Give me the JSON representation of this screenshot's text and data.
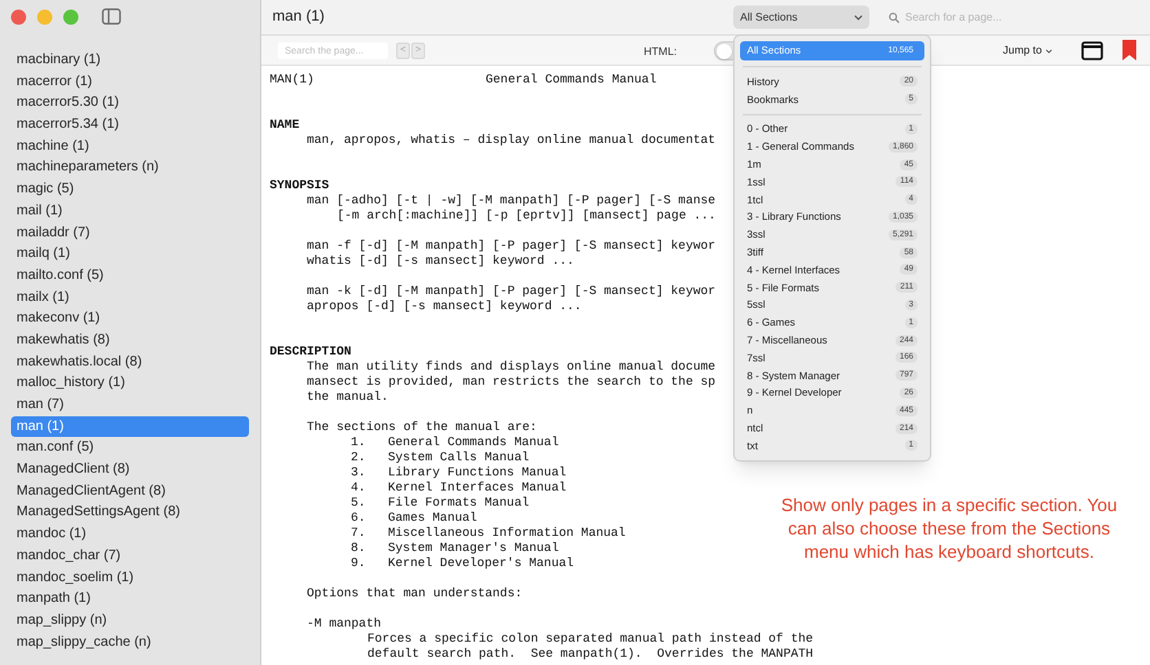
{
  "sidebar": {
    "items": [
      {
        "label": "macbinary (1)",
        "selected": false
      },
      {
        "label": "macerror (1)",
        "selected": false
      },
      {
        "label": "macerror5.30 (1)",
        "selected": false
      },
      {
        "label": "macerror5.34 (1)",
        "selected": false
      },
      {
        "label": "machine (1)",
        "selected": false
      },
      {
        "label": "machineparameters (n)",
        "selected": false
      },
      {
        "label": "magic (5)",
        "selected": false
      },
      {
        "label": "mail (1)",
        "selected": false
      },
      {
        "label": "mailaddr (7)",
        "selected": false
      },
      {
        "label": "mailq (1)",
        "selected": false
      },
      {
        "label": "mailto.conf (5)",
        "selected": false
      },
      {
        "label": "mailx (1)",
        "selected": false
      },
      {
        "label": "makeconv (1)",
        "selected": false
      },
      {
        "label": "makewhatis (8)",
        "selected": false
      },
      {
        "label": "makewhatis.local (8)",
        "selected": false
      },
      {
        "label": "malloc_history (1)",
        "selected": false
      },
      {
        "label": "man (7)",
        "selected": false
      },
      {
        "label": "man (1)",
        "selected": true
      },
      {
        "label": "man.conf (5)",
        "selected": false
      },
      {
        "label": "ManagedClient (8)",
        "selected": false
      },
      {
        "label": "ManagedClientAgent (8)",
        "selected": false
      },
      {
        "label": "ManagedSettingsAgent (8)",
        "selected": false
      },
      {
        "label": "mandoc (1)",
        "selected": false
      },
      {
        "label": "mandoc_char (7)",
        "selected": false
      },
      {
        "label": "mandoc_soelim (1)",
        "selected": false
      },
      {
        "label": "manpath (1)",
        "selected": false
      },
      {
        "label": "map_slippy (n)",
        "selected": false
      },
      {
        "label": "map_slippy_cache (n)",
        "selected": false
      }
    ]
  },
  "toolbar": {
    "title": "man (1)",
    "section_popup": "All Sections",
    "search": {
      "placeholder": "Search for a page..."
    }
  },
  "find_bar": {
    "search": {
      "placeholder": "Search the page..."
    },
    "prev": "<",
    "next": ">",
    "html_label": "HTML:",
    "html_on": false,
    "jump_to": "Jump to"
  },
  "page": {
    "header": {
      "left": "MAN(1)",
      "center": "General Commands Manual"
    },
    "lines": [
      {
        "kind": "blank"
      },
      {
        "kind": "blank"
      },
      {
        "kind": "heading",
        "text": "NAME"
      },
      {
        "kind": "indent",
        "text": "man, apropos, whatis – display online manual documentat"
      },
      {
        "kind": "blank"
      },
      {
        "kind": "blank"
      },
      {
        "kind": "heading",
        "text": "SYNOPSIS"
      },
      {
        "kind": "indent",
        "text": "man [-adho] [-t | -w] [-M manpath] [-P pager] [-S manse"
      },
      {
        "kind": "wrap",
        "text": "[-m arch[:machine]] [-p [eprtv]] [mansect] page ..."
      },
      {
        "kind": "blank"
      },
      {
        "kind": "indent",
        "text": "man -f [-d] [-M manpath] [-P pager] [-S mansect] keywor"
      },
      {
        "kind": "indent",
        "text": "whatis [-d] [-s mansect] keyword ..."
      },
      {
        "kind": "blank"
      },
      {
        "kind": "indent",
        "text": "man -k [-d] [-M manpath] [-P pager] [-S mansect] keywor"
      },
      {
        "kind": "indent",
        "text": "apropos [-d] [-s mansect] keyword ..."
      },
      {
        "kind": "blank"
      },
      {
        "kind": "blank"
      },
      {
        "kind": "heading",
        "text": "DESCRIPTION"
      },
      {
        "kind": "indent",
        "text": "The man utility finds and displays online manual docume"
      },
      {
        "kind": "indent",
        "text": "mansect is provided, man restricts the search to the sp"
      },
      {
        "kind": "indent",
        "text": "the manual."
      },
      {
        "kind": "blank"
      },
      {
        "kind": "indent",
        "text": "The sections of the manual are:"
      },
      {
        "kind": "item",
        "number": "1.",
        "text": "General Commands Manual"
      },
      {
        "kind": "item",
        "number": "2.",
        "text": "System Calls Manual"
      },
      {
        "kind": "item",
        "number": "3.",
        "text": "Library Functions Manual"
      },
      {
        "kind": "item",
        "number": "4.",
        "text": "Kernel Interfaces Manual"
      },
      {
        "kind": "item",
        "number": "5.",
        "text": "File Formats Manual"
      },
      {
        "kind": "item",
        "number": "6.",
        "text": "Games Manual"
      },
      {
        "kind": "item",
        "number": "7.",
        "text": "Miscellaneous Information Manual"
      },
      {
        "kind": "item",
        "number": "8.",
        "text": "System Manager's Manual"
      },
      {
        "kind": "item",
        "number": "9.",
        "text": "Kernel Developer's Manual"
      },
      {
        "kind": "blank"
      },
      {
        "kind": "indent",
        "text": "Options that man understands:"
      },
      {
        "kind": "blank"
      },
      {
        "kind": "indent",
        "text": "-M manpath"
      },
      {
        "kind": "deep",
        "text": "Forces a specific colon separated manual path instead of the"
      },
      {
        "kind": "deep",
        "text": "default search path.  See manpath(1).  Overrides the MANPATH"
      }
    ]
  },
  "section_menu": {
    "groups": [
      [
        {
          "label": "All Sections",
          "count": "10,565",
          "selected": true
        }
      ],
      [
        {
          "label": "History",
          "count": "20",
          "selected": false
        },
        {
          "label": "Bookmarks",
          "count": "5",
          "selected": false
        }
      ],
      [
        {
          "label": "0 - Other",
          "count": "1",
          "selected": false
        },
        {
          "label": "1 - General Commands",
          "count": "1,860",
          "selected": false
        },
        {
          "label": "1m",
          "count": "45",
          "selected": false
        },
        {
          "label": "1ssl",
          "count": "114",
          "selected": false
        },
        {
          "label": "1tcl",
          "count": "4",
          "selected": false
        },
        {
          "label": "3 - Library Functions",
          "count": "1,035",
          "selected": false
        },
        {
          "label": "3ssl",
          "count": "5,291",
          "selected": false
        },
        {
          "label": "3tiff",
          "count": "58",
          "selected": false
        },
        {
          "label": "4 - Kernel Interfaces",
          "count": "49",
          "selected": false
        },
        {
          "label": "5 - File Formats",
          "count": "211",
          "selected": false
        },
        {
          "label": "5ssl",
          "count": "3",
          "selected": false
        },
        {
          "label": "6 - Games",
          "count": "1",
          "selected": false
        },
        {
          "label": "7 - Miscellaneous",
          "count": "244",
          "selected": false
        },
        {
          "label": "7ssl",
          "count": "166",
          "selected": false
        },
        {
          "label": "8 - System Manager",
          "count": "797",
          "selected": false
        },
        {
          "label": "9 - Kernel Developer",
          "count": "26",
          "selected": false
        },
        {
          "label": "n",
          "count": "445",
          "selected": false
        },
        {
          "label": "ntcl",
          "count": "214",
          "selected": false
        },
        {
          "label": "txt",
          "count": "1",
          "selected": false
        }
      ]
    ]
  },
  "annotation": "Show only pages in a specific section. You can also choose these from the Sections menu which has keyboard shortcuts."
}
